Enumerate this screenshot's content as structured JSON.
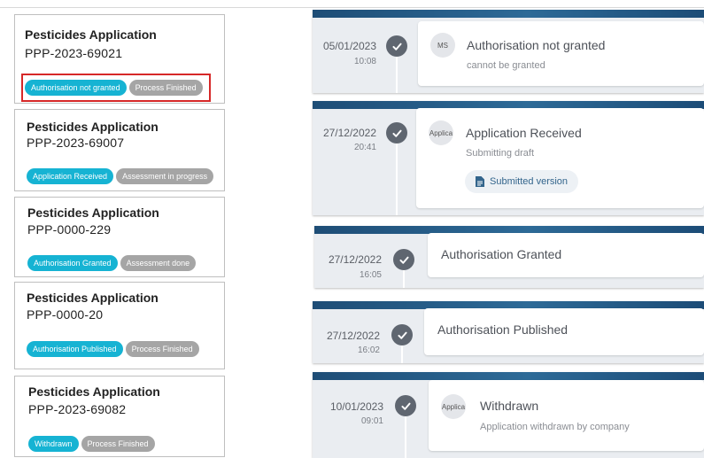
{
  "cards": [
    {
      "title": "Pesticides Application",
      "id": "PPP-2023-69021",
      "badges": [
        "Authorisation not granted",
        "Process Finished"
      ]
    },
    {
      "title": "Pesticides Application",
      "id": "PPP-2023-69007",
      "badges": [
        "Application Received",
        "Assessment in progress"
      ]
    },
    {
      "title": "Pesticides Application",
      "id": "PPP-0000-229",
      "badges": [
        "Authorisation Granted",
        "Assessment done"
      ]
    },
    {
      "title": "Pesticides Application",
      "id": "PPP-0000-20",
      "badges": [
        "Authorisation Published",
        "Process Finished"
      ]
    },
    {
      "title": "Pesticides Application",
      "id": "PPP-2023-69082",
      "badges": [
        "Withdrawn",
        "Process Finished"
      ]
    }
  ],
  "timeline": [
    {
      "date": "05/01/2023",
      "time": "10:08",
      "avatar": "MS",
      "title": "Authorisation not granted",
      "subtitle": "cannot be granted"
    },
    {
      "date": "27/12/2022",
      "time": "20:41",
      "avatar": "Applica",
      "title": "Application Received",
      "subtitle": "Submitting draft",
      "button": "Submitted version"
    },
    {
      "date": "27/12/2022",
      "time": "16:05",
      "title": "Authorisation Granted"
    },
    {
      "date": "27/12/2022",
      "time": "16:02",
      "title": "Authorisation Published"
    },
    {
      "date": "10/01/2023",
      "time": "09:01",
      "avatar": "Applica",
      "title": "Withdrawn",
      "subtitle": "Application withdrawn by company"
    }
  ]
}
